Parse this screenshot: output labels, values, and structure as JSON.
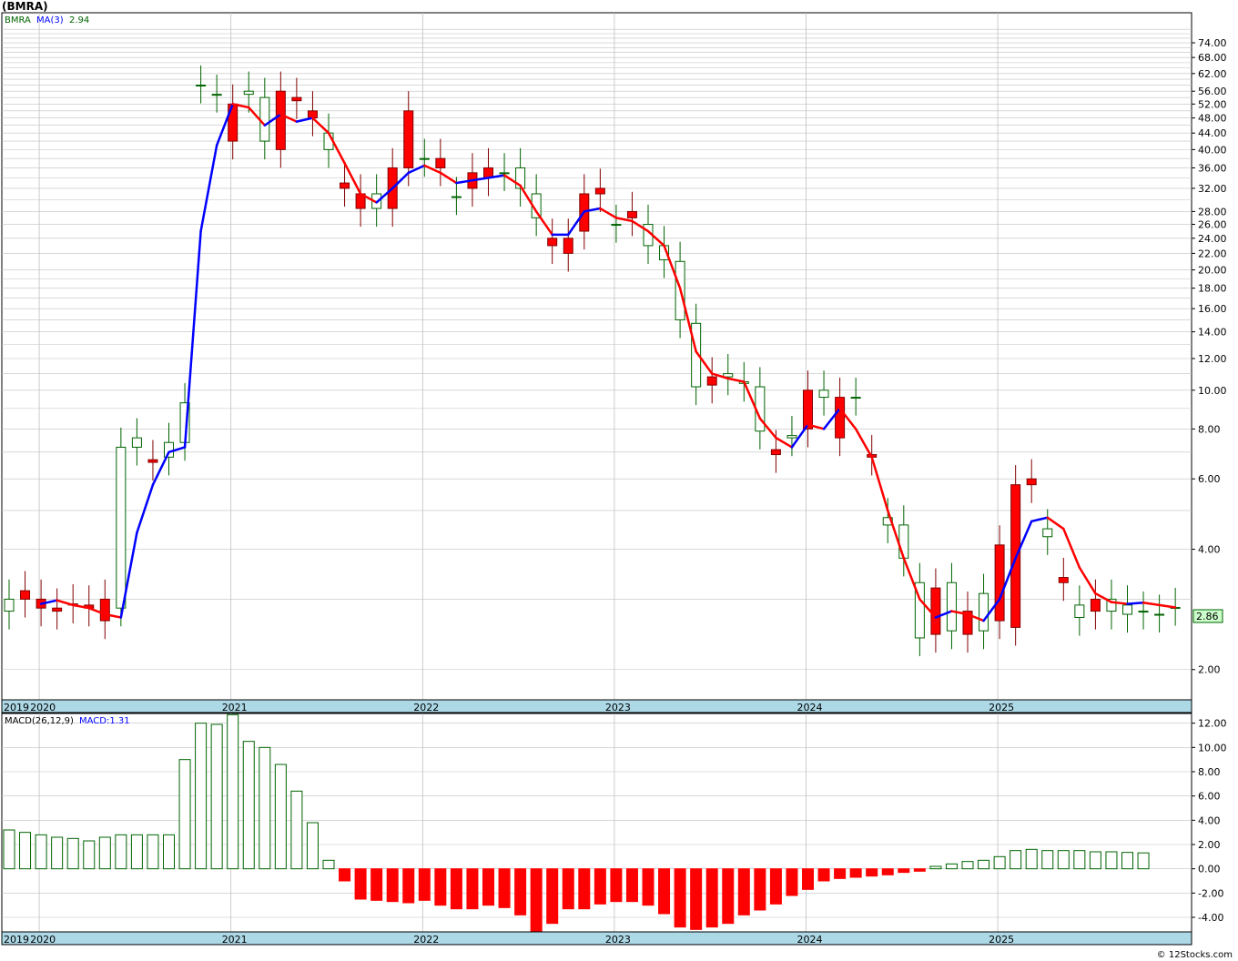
{
  "title": "(BMRA)",
  "credit": "© 12Stocks.com",
  "colors": {
    "up_candle_stroke": "#006400",
    "down_candle_fill": "#ff0000",
    "ma_up": "#0000ff",
    "ma_down": "#ff0000",
    "macd_pos_stroke": "#006400",
    "macd_neg_fill": "#ff0000",
    "grid": "#c0c0c0",
    "axis_band": "#add8e6",
    "price_badge_bg": "#ccffcc"
  },
  "price_panel": {
    "legend_symbol": "BMRA",
    "legend_ma": "MA(3)",
    "legend_ma_value": "2.94",
    "last_price": "2.86",
    "y_ticks": [
      "74.00",
      "68.00",
      "62.00",
      "56.00",
      "52.00",
      "48.00",
      "44.00",
      "40.00",
      "36.00",
      "32.00",
      "28.00",
      "26.00",
      "24.00",
      "22.00",
      "20.00",
      "18.00",
      "16.00",
      "14.00",
      "12.00",
      "10.00",
      "8.00",
      "6.00",
      "4.00",
      "2.00"
    ]
  },
  "macd_panel": {
    "legend_label": "MACD(26,12,9)",
    "legend_value": "MACD:1.31",
    "y_ticks": [
      "12.00",
      "10.00",
      "8.00",
      "6.00",
      "4.00",
      "2.00",
      "0.00",
      "-2.00",
      "-4.00"
    ]
  },
  "x_axis_years": [
    "2019",
    "2020",
    "2021",
    "2022",
    "2023",
    "2024",
    "2025"
  ],
  "chart_data": [
    {
      "type": "candlestick",
      "title": "(BMRA)",
      "scale": "log",
      "ylim": [
        1.68,
        88
      ],
      "x": [
        "2019-11",
        "2019-12",
        "2020-01",
        "2020-02",
        "2020-03",
        "2020-04",
        "2020-05",
        "2020-06",
        "2020-07",
        "2020-08",
        "2020-09",
        "2020-10",
        "2020-11",
        "2020-12",
        "2021-01",
        "2021-02",
        "2021-03",
        "2021-04",
        "2021-05",
        "2021-06",
        "2021-07",
        "2021-08",
        "2021-09",
        "2021-10",
        "2021-11",
        "2021-12",
        "2022-01",
        "2022-02",
        "2022-03",
        "2022-04",
        "2022-05",
        "2022-06",
        "2022-07",
        "2022-08",
        "2022-09",
        "2022-10",
        "2022-11",
        "2022-12",
        "2023-01",
        "2023-02",
        "2023-03",
        "2023-04",
        "2023-05",
        "2023-06",
        "2023-07",
        "2023-08",
        "2023-09",
        "2023-10",
        "2023-11",
        "2023-12",
        "2024-01",
        "2024-02",
        "2024-03",
        "2024-04",
        "2024-05",
        "2024-06",
        "2024-07",
        "2024-08",
        "2024-09",
        "2024-10",
        "2024-11",
        "2024-12",
        "2025-01",
        "2025-02",
        "2025-03",
        "2025-04",
        "2025-05",
        "2025-06",
        "2025-07",
        "2025-08",
        "2025-09",
        "2025-10",
        "2025-11",
        "2025-12"
      ],
      "open": [
        2.8,
        3.15,
        3.0,
        2.85,
        2.92,
        2.9,
        3.0,
        2.85,
        7.2,
        6.7,
        6.8,
        7.4,
        58.0,
        55.0,
        52.0,
        55.0,
        42.0,
        56.0,
        54.0,
        50.0,
        40.0,
        33.0,
        31.0,
        28.5,
        36.0,
        50.0,
        38.0,
        38.0,
        30.5,
        35.0,
        36.0,
        35.0,
        32.0,
        27.0,
        24.0,
        24.0,
        31.0,
        32.0,
        26.0,
        28.0,
        23.0,
        21.2,
        15.0,
        10.2,
        10.8,
        10.8,
        10.4,
        7.9,
        7.1,
        7.6,
        10.0,
        9.6,
        9.6,
        9.6,
        6.9,
        4.6,
        3.8,
        2.4,
        3.2,
        2.5,
        2.8,
        2.5,
        4.1,
        5.8,
        6.0,
        4.3,
        3.4,
        2.7,
        3.0,
        2.8,
        2.75
      ],
      "close": [
        3.0,
        3.0,
        2.85,
        2.8,
        2.9,
        2.85,
        2.65,
        7.2,
        7.6,
        6.6,
        7.4,
        9.3,
        58.0,
        55.0,
        42.0,
        56.0,
        54.0,
        40.0,
        53.0,
        48.0,
        44.0,
        32.0,
        28.5,
        31.0,
        28.5,
        36.0,
        38.0,
        36.0,
        30.5,
        32.0,
        34.0,
        35.0,
        36.0,
        31.0,
        23.0,
        22.0,
        25.0,
        31.0,
        26.0,
        27.0,
        26.0,
        23.0,
        21.0,
        14.7,
        10.3,
        11.0,
        10.5,
        10.2,
        6.9,
        7.7,
        8.0,
        10.0,
        7.6,
        9.6,
        6.8,
        4.8,
        4.6,
        3.3,
        2.45,
        3.3,
        2.45,
        3.1,
        2.65,
        2.55,
        5.8,
        4.5,
        3.3,
        2.9,
        2.8,
        3.0,
        2.9,
        2.8,
        2.75,
        2.86
      ],
      "ma": [
        null,
        null,
        2.92,
        2.98,
        2.9,
        2.85,
        2.75,
        2.7,
        4.4,
        5.8,
        7.0,
        7.2,
        25.0,
        41.0,
        52.0,
        51.0,
        46.0,
        49.0,
        47.0,
        48.0,
        44.0,
        37.0,
        31.0,
        29.5,
        32.0,
        35.0,
        36.5,
        35.0,
        33.0,
        33.5,
        34.0,
        34.5,
        32.5,
        28.0,
        24.5,
        24.5,
        28.0,
        28.5,
        27.0,
        26.5,
        25.0,
        23.0,
        18.0,
        12.5,
        11.0,
        10.7,
        10.5,
        8.5,
        7.6,
        7.2,
        8.2,
        8.0,
        9.0,
        8.0,
        6.8,
        5.0,
        3.8,
        3.0,
        2.7,
        2.8,
        2.75,
        2.65,
        3.0,
        3.8,
        4.7,
        4.8,
        4.5,
        3.6,
        3.1,
        2.95,
        2.92,
        2.94,
        2.9,
        2.86
      ]
    },
    {
      "type": "bar",
      "title": "MACD(26,12,9)",
      "ylim": [
        -5.2,
        12.8
      ],
      "values": [
        3.2,
        3.0,
        2.8,
        2.6,
        2.5,
        2.3,
        2.6,
        2.8,
        2.8,
        2.8,
        2.8,
        9.0,
        12.0,
        11.9,
        12.7,
        10.5,
        10.0,
        8.6,
        6.4,
        3.8,
        0.7,
        -1.0,
        -2.5,
        -2.6,
        -2.7,
        -2.8,
        -2.6,
        -3.0,
        -3.3,
        -3.3,
        -3.0,
        -3.2,
        -3.8,
        -5.2,
        -4.5,
        -3.3,
        -3.3,
        -2.9,
        -2.7,
        -2.7,
        -3.0,
        -3.7,
        -4.8,
        -5.0,
        -4.8,
        -4.5,
        -3.8,
        -3.4,
        -2.9,
        -2.2,
        -1.7,
        -1.0,
        -0.8,
        -0.7,
        -0.6,
        -0.5,
        -0.3,
        -0.2,
        0.2,
        0.4,
        0.6,
        0.7,
        1.0,
        1.5,
        1.6,
        1.5,
        1.5,
        1.5,
        1.4,
        1.4,
        1.35,
        1.31
      ]
    }
  ]
}
